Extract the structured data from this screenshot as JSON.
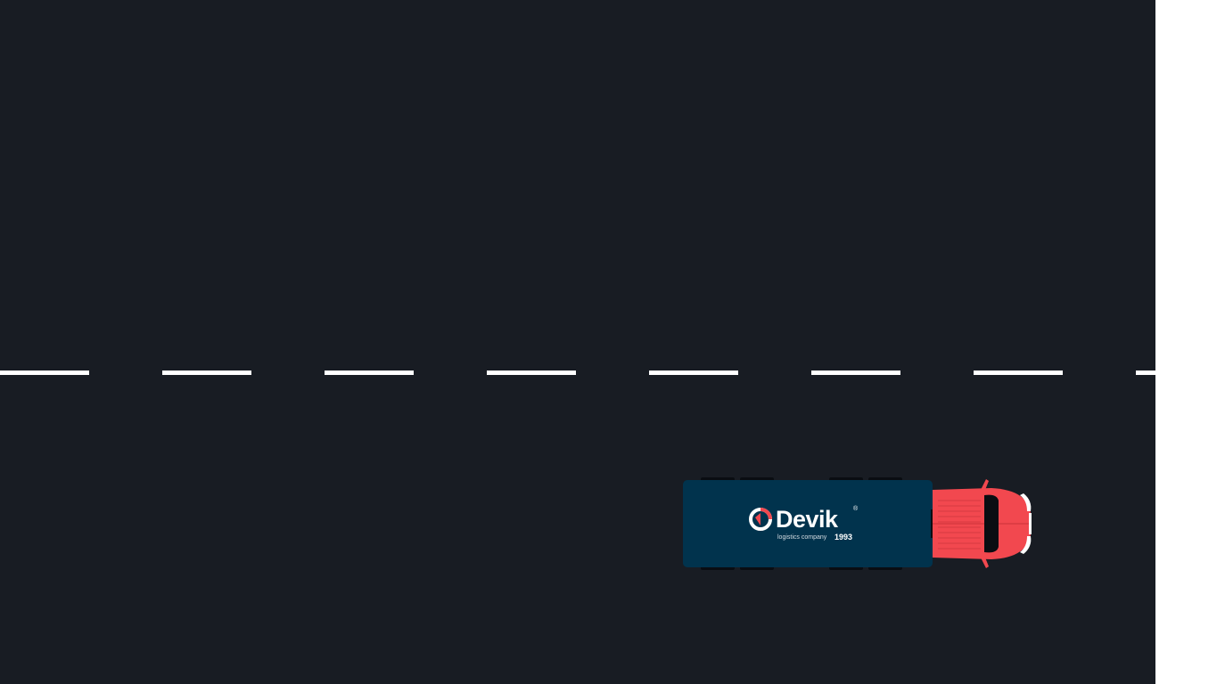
{
  "scene": {
    "road_color": "#181c23",
    "lane_marking_color": "#ffffff",
    "truck": {
      "trailer_color": "#01334d",
      "cab_color": "#f2484f",
      "logo": {
        "name": "Devik",
        "registered": "®",
        "tagline": "logistics company",
        "year": "1993"
      }
    }
  }
}
